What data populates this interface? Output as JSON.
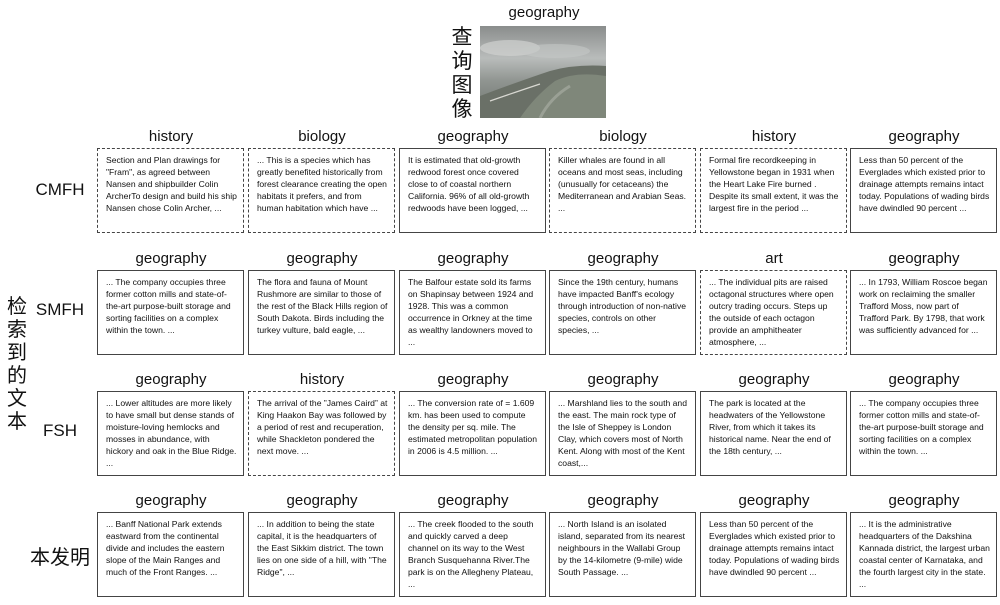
{
  "query": {
    "label": "查询图像",
    "category": "geography",
    "image": "aerial-coastline-photo"
  },
  "side_label": "检索到的文本",
  "rows": [
    {
      "method": "CMFH",
      "items": [
        {
          "category": "history",
          "relevant": false,
          "text": "Section and Plan drawings for \"Fram\", as agreed between Nansen and shipbuilder Colin ArcherTo design and build his ship Nansen chose Colin Archer, ..."
        },
        {
          "category": "biology",
          "relevant": false,
          "text": "... This is a species which has greatly benefited historically from forest clearance creating the open habitats it prefers, and from human habitation which have ..."
        },
        {
          "category": "geography",
          "relevant": true,
          "text": "It is estimated that old-growth redwood forest once covered close to  of coastal northern California. 96% of all old-growth redwoods have been logged, ..."
        },
        {
          "category": "biology",
          "relevant": false,
          "text": "Killer whales are found in all oceans and most seas, including (unusually for cetaceans) the Mediterranean and Arabian Seas. ..."
        },
        {
          "category": "history",
          "relevant": false,
          "text": "Formal fire recordkeeping in Yellowstone began in 1931 when the Heart Lake Fire burned . Despite its small extent, it was the largest fire in the period ..."
        },
        {
          "category": "geography",
          "relevant": true,
          "text": "Less than 50 percent of the Everglades which existed prior to drainage attempts remains intact today. Populations of wading birds have dwindled 90 percent ..."
        }
      ]
    },
    {
      "method": "SMFH",
      "items": [
        {
          "category": "geography",
          "relevant": true,
          "text": "... The company occupies three former cotton mills and state-of-the-art purpose-built storage and sorting facilities on a  complex within the town. ..."
        },
        {
          "category": "geography",
          "relevant": true,
          "text": "The flora and fauna of Mount Rushmore are similar to those of the rest of the Black Hills region of South Dakota. Birds including the turkey vulture, bald eagle, ..."
        },
        {
          "category": "geography",
          "relevant": true,
          "text": "The Balfour estate sold its farms on Shapinsay between 1924 and 1928. This was a common occurrence in Orkney at the time as wealthy landowners moved to ..."
        },
        {
          "category": "geography",
          "relevant": true,
          "text": "Since the 19th century, humans have impacted Banff's ecology through introduction of non-native species, controls on other species, ..."
        },
        {
          "category": "art",
          "relevant": false,
          "text": "... The individual pits are raised octagonal structures where open outcry trading occurs. Steps up the outside of each octagon provide an amphitheater atmosphere, ..."
        },
        {
          "category": "geography",
          "relevant": true,
          "text": "... In 1793, William Roscoe began work on reclaiming the smaller Trafford Moss, now part of Trafford Park. By 1798, that work was sufficiently advanced for ..."
        }
      ]
    },
    {
      "method": "FSH",
      "items": [
        {
          "category": "geography",
          "relevant": true,
          "text": "... Lower altitudes are more likely to have small but dense stands of moisture-loving hemlocks and mosses in abundance, with hickory and oak in the Blue Ridge. ..."
        },
        {
          "category": "history",
          "relevant": false,
          "text": "The arrival of the ”James Caird” at King Haakon Bay was followed by a period of rest and recuperation, while Shackleton pondered the next move. ..."
        },
        {
          "category": "geography",
          "relevant": true,
          "text": "... The conversion rate of  = 1.609 km. has been used to compute the density per sq. mile. The estimated metropolitan population in 2006 is 4.5  million. ..."
        },
        {
          "category": "geography",
          "relevant": true,
          "text": "... Marshland lies to the south and the east. The main rock type of the Isle of Sheppey is London Clay, which covers most of North Kent. Along with most of the Kent coast,..."
        },
        {
          "category": "geography",
          "relevant": true,
          "text": "The park is located at the headwaters of the Yellowstone River, from which it takes its historical name. Near the end of the 18th century, ..."
        },
        {
          "category": "geography",
          "relevant": true,
          "text": "... The company occupies three former cotton mills and state-of-the-art purpose-built storage and sorting facilities on a  complex within the town. ..."
        }
      ]
    },
    {
      "method": "本发明",
      "items": [
        {
          "category": "geography",
          "relevant": true,
          "text": "... Banff National Park extends eastward from the continental divide and includes the eastern slope of the Main Ranges and much of the Front Ranges. ..."
        },
        {
          "category": "geography",
          "relevant": true,
          "text": "... In addition to being the state capital, it is the headquarters of the East Sikkim district. The town lies on one side of a hill, with \"The Ridge\", ..."
        },
        {
          "category": "geography",
          "relevant": true,
          "text": "... The creek flooded to the south and quickly carved a deep channel on its way to the West Branch Susquehanna River.The park is on the Allegheny Plateau, ..."
        },
        {
          "category": "geography",
          "relevant": true,
          "text": "... North Island is an isolated island, separated from its nearest neighbours in the Wallabi Group by the 14-kilometre (9-mile) wide South Passage. ..."
        },
        {
          "category": "geography",
          "relevant": true,
          "text": "Less than 50 percent of the Everglades which existed prior to drainage attempts remains intact today. Populations of wading birds have dwindled 90 percent ..."
        },
        {
          "category": "geography",
          "relevant": true,
          "text": "... It is the administrative headquarters of the Dakshina Kannada district, the largest urban coastal center of Karnataka, and the fourth largest city in the state. ..."
        }
      ]
    }
  ]
}
